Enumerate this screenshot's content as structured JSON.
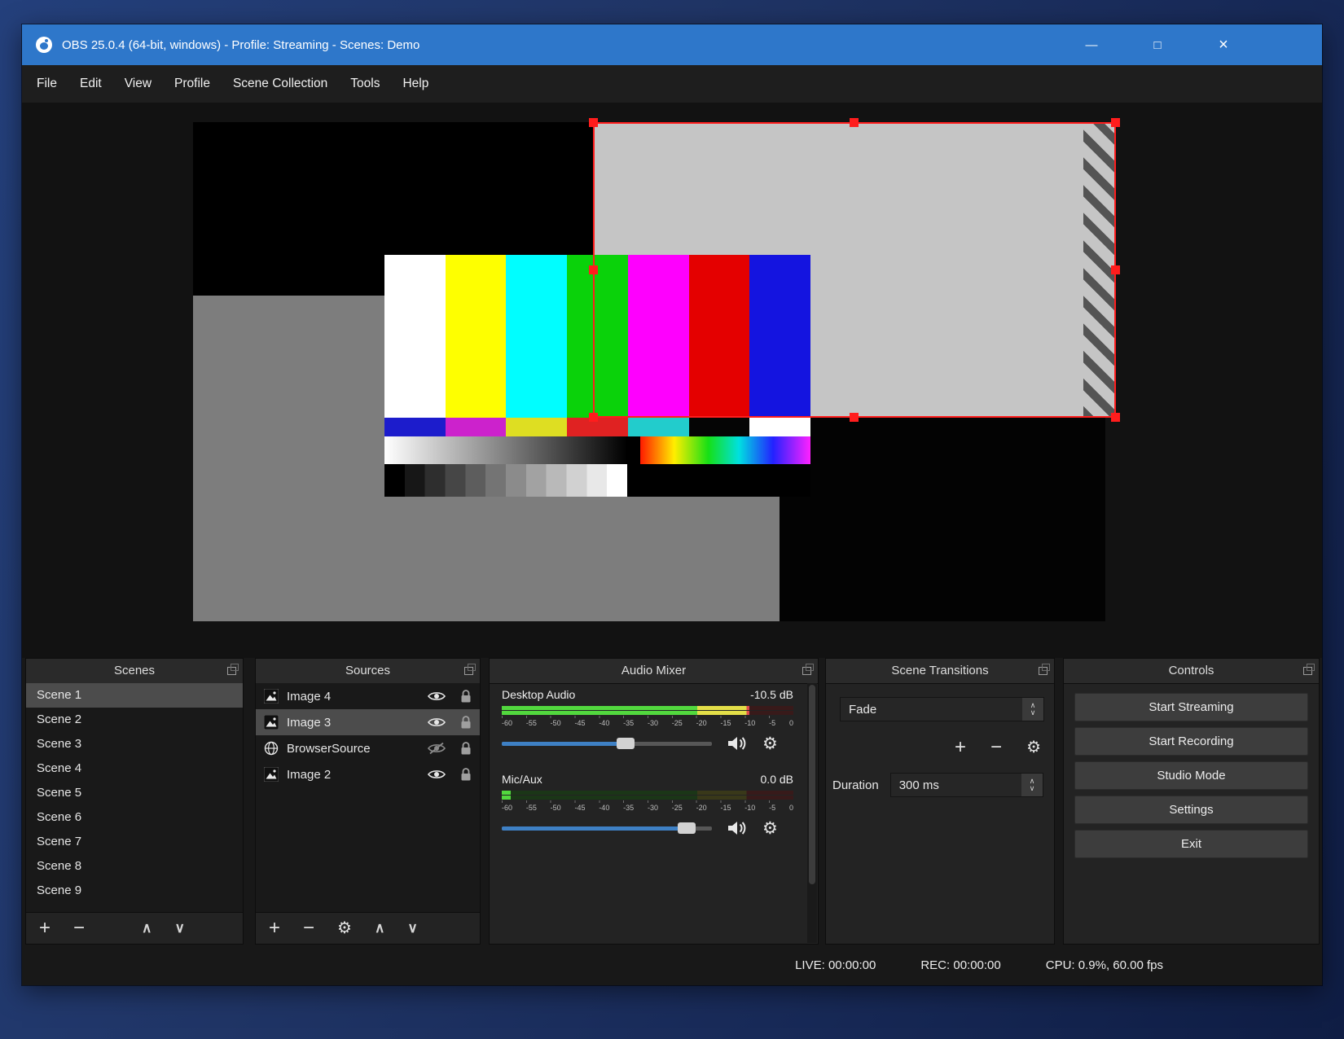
{
  "colors": {
    "titlebar_blue": "#2e77ca",
    "selection_red": "#ff1d1d",
    "fader_blue": "#3e80c4"
  },
  "titlebar": {
    "title": "OBS 25.0.4 (64-bit, windows) - Profile: Streaming - Scenes: Demo",
    "minimize_glyph": "—",
    "maximize_glyph": "□",
    "close_glyph": "×"
  },
  "menu": {
    "items": [
      "File",
      "Edit",
      "View",
      "Profile",
      "Scene Collection",
      "Tools",
      "Help"
    ]
  },
  "icons": {
    "plus": "+",
    "minus": "−",
    "up": "∧",
    "down": "∨",
    "gear": "⚙"
  },
  "scenes": {
    "title": "Scenes",
    "selected_index": 0,
    "items": [
      "Scene 1",
      "Scene 2",
      "Scene 3",
      "Scene 4",
      "Scene 5",
      "Scene 6",
      "Scene 7",
      "Scene 8",
      "Scene 9"
    ]
  },
  "sources": {
    "title": "Sources",
    "items": [
      {
        "name": "Image 4",
        "type": "image",
        "visible": true,
        "locked": true,
        "selected": false
      },
      {
        "name": "Image 3",
        "type": "image",
        "visible": true,
        "locked": true,
        "selected": true
      },
      {
        "name": "BrowserSource",
        "type": "browser",
        "visible": false,
        "locked": true,
        "selected": false
      },
      {
        "name": "Image 2",
        "type": "image",
        "visible": true,
        "locked": true,
        "selected": false
      }
    ]
  },
  "audio_mixer": {
    "title": "Audio Mixer",
    "ticks": [
      "-60",
      "-55",
      "-50",
      "-45",
      "-40",
      "-35",
      "-30",
      "-25",
      "-20",
      "-15",
      "-10",
      "-5",
      "0"
    ],
    "channels": [
      {
        "name": "Desktop Audio",
        "db": "-10.5 dB",
        "dim_pct": 15,
        "fader_pct": 59
      },
      {
        "name": "Mic/Aux",
        "db": "0.0 dB",
        "dim_pct": 97,
        "fader_pct": 88
      }
    ]
  },
  "transitions": {
    "title": "Scene Transitions",
    "transition": "Fade",
    "duration_label": "Duration",
    "duration_value": "300 ms"
  },
  "controls": {
    "title": "Controls",
    "buttons": [
      "Start Streaming",
      "Start Recording",
      "Studio Mode",
      "Settings",
      "Exit"
    ]
  },
  "status": {
    "live": "LIVE: 00:00:00",
    "rec": "REC: 00:00:00",
    "cpu": "CPU: 0.9%, 60.00 fps"
  }
}
